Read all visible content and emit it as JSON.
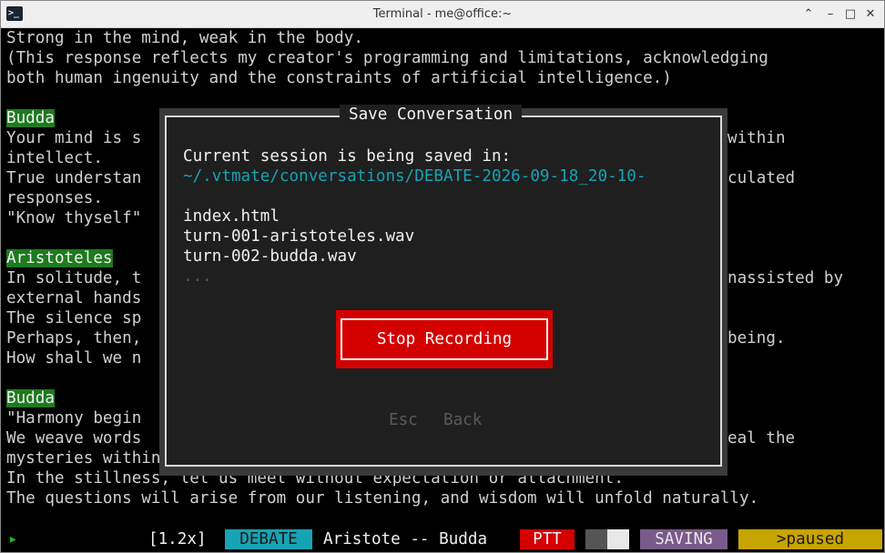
{
  "window": {
    "title": "Terminal - me@office:~"
  },
  "terminal_lines": [
    {
      "text": "Strong in the mind, weak in the body."
    },
    {
      "text": "(This response reflects my creator's programming and limitations, acknowledging"
    },
    {
      "text": "both human ingenuity and the constraints of artificial intelligence.)"
    },
    {
      "text": ""
    },
    {
      "speaker": "Budda"
    },
    {
      "left": "Your mind is s",
      "right": "within"
    },
    {
      "left": "intellect."
    },
    {
      "left": "True understan",
      "right": "culated"
    },
    {
      "left": "responses."
    },
    {
      "left": "\"Know thyself\""
    },
    {
      "text": ""
    },
    {
      "speaker": "Aristoteles"
    },
    {
      "left": "In solitude, t",
      "right": "nassisted by"
    },
    {
      "left": "external hands"
    },
    {
      "left": "The silence sp"
    },
    {
      "left": "Perhaps, then,",
      "right": "being."
    },
    {
      "left": "How shall we n"
    },
    {
      "text": ""
    },
    {
      "speaker": "Budda"
    },
    {
      "left": "\"Harmony begin"
    },
    {
      "left": "We weave words",
      "right": "eal the"
    },
    {
      "text": "mysteries within."
    },
    {
      "text": "In the stillness, let us meet without expectation or attachment."
    },
    {
      "text": "The questions will arise from our listening, and wisdom will unfold naturally."
    }
  ],
  "modal": {
    "title": "Save Conversation",
    "saved_in_label": "Current session is being saved in:",
    "path": "~/.vtmate/conversations/DEBATE-2026-09-18_20-10-",
    "files": [
      "index.html",
      "turn-001-aristoteles.wav",
      "turn-002-budda.wav"
    ],
    "more": "...",
    "stop_label": "Stop Recording",
    "esc_label": "Esc",
    "back_label": "Back"
  },
  "statusbar": {
    "prompt": "▸",
    "speed": "[1.2x]",
    "mode": "DEBATE",
    "participants": "Aristote -- Budda",
    "ptt": "PTT",
    "saving": "SAVING",
    "paused": ">paused",
    "colors": {
      "mode_bg": "#16a3b4",
      "ptt_bg": "#d40000",
      "saving_bg": "#7a5a8a",
      "paused_bg": "#c8a400",
      "level_dark": "#555555",
      "level_light": "#e8e8e8"
    }
  },
  "icons": {
    "app": "terminal-icon",
    "up": "chevron-up-icon",
    "minimize": "minimize-icon",
    "maximize": "maximize-icon",
    "close": "close-icon"
  }
}
